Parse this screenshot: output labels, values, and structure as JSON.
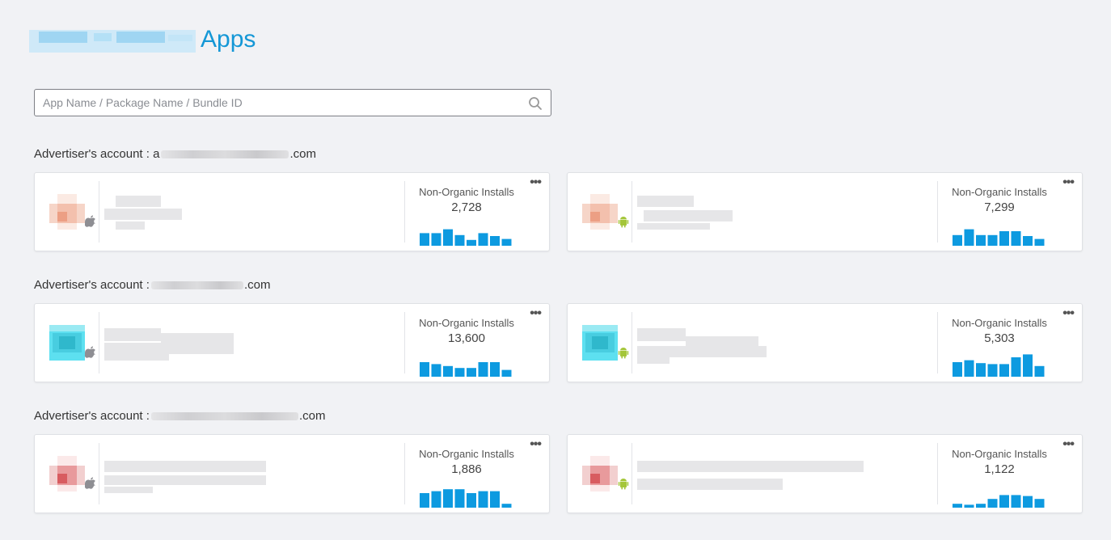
{
  "page": {
    "title": "Apps"
  },
  "search": {
    "placeholder": "App Name / Package Name / Bundle ID",
    "value": ""
  },
  "colors": {
    "accent": "#1497d6",
    "bar": "#0d9ae0",
    "android": "#a4c639",
    "apple": "#8e8e93"
  },
  "groups": [
    {
      "account_prefix": "Advertiser's account : a",
      "account_suffix": ".com",
      "apps": [
        {
          "platform": "apple-icon",
          "metric_label": "Non-Organic Installs",
          "metric_value": "2,728",
          "icon_palette": "coral",
          "bars": [
            0.65,
            0.65,
            0.85,
            0.55,
            0.3,
            0.65,
            0.5,
            0.35
          ]
        },
        {
          "platform": "android-icon",
          "metric_label": "Non-Organic Installs",
          "metric_value": "7,299",
          "icon_palette": "coral",
          "bars": [
            0.55,
            0.85,
            0.55,
            0.55,
            0.75,
            0.75,
            0.5,
            0.35
          ]
        }
      ]
    },
    {
      "account_prefix": "Advertiser's account : ",
      "account_suffix": ".com",
      "apps": [
        {
          "platform": "apple-icon",
          "metric_label": "Non-Organic Installs",
          "metric_value": "13,600",
          "icon_palette": "cyan",
          "bars": [
            0.75,
            0.65,
            0.55,
            0.45,
            0.45,
            0.75,
            0.75,
            0.35
          ]
        },
        {
          "platform": "android-icon",
          "metric_label": "Non-Organic Installs",
          "metric_value": "5,303",
          "icon_palette": "cyan",
          "bars": [
            0.75,
            0.85,
            0.7,
            0.65,
            0.65,
            1.0,
            1.15,
            0.55
          ]
        }
      ]
    },
    {
      "account_prefix": "Advertiser's account : ",
      "account_suffix": ".com",
      "apps": [
        {
          "platform": "apple-icon",
          "metric_label": "Non-Organic Installs",
          "metric_value": "1,886",
          "icon_palette": "red",
          "bars": [
            0.75,
            0.85,
            0.95,
            0.95,
            0.75,
            0.85,
            0.85,
            0.2
          ]
        },
        {
          "platform": "android-icon",
          "metric_label": "Non-Organic Installs",
          "metric_value": "1,122",
          "icon_palette": "red",
          "bars": [
            0.2,
            0.15,
            0.2,
            0.45,
            0.65,
            0.65,
            0.6,
            0.45
          ]
        }
      ]
    }
  ]
}
